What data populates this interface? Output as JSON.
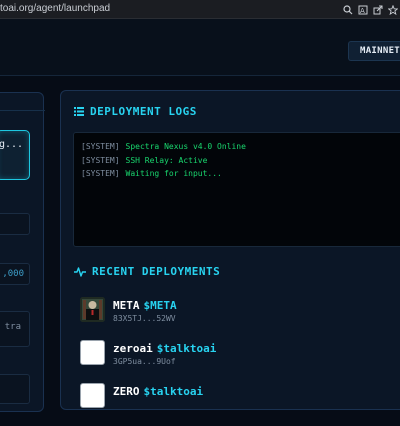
{
  "browser": {
    "url": "toai.org/agent/launchpad",
    "icons": [
      "search-icon",
      "zoom-icon",
      "share-icon",
      "star-icon"
    ]
  },
  "header": {
    "network_label": "MAINNET",
    "network_status_color": "#19e68c"
  },
  "left_panel": {
    "status_text": "g...",
    "amount_suffix": ",000",
    "textarea_fragment": "tra"
  },
  "logs": {
    "title": "DEPLOYMENT LOGS",
    "lines": [
      {
        "tag": "[SYSTEM]",
        "message": "Spectra Nexus v4.0 Online"
      },
      {
        "tag": "[SYSTEM]",
        "message": "SSH Relay: Active"
      },
      {
        "tag": "[SYSTEM]",
        "message": "Waiting for input..."
      }
    ]
  },
  "deployments": {
    "title": "RECENT DEPLOYMENTS",
    "items": [
      {
        "name": "META",
        "ticker": "$META",
        "address": "83X5TJ...52WV"
      },
      {
        "name": "zeroai",
        "ticker": "$talktoai",
        "address": "3GP5ua...9Uof"
      },
      {
        "name": "ZERO",
        "ticker": "$talktoai",
        "address": ""
      }
    ]
  },
  "colors": {
    "accent": "#28d3f0",
    "log_green": "#19d66e",
    "background": "#060c16"
  }
}
